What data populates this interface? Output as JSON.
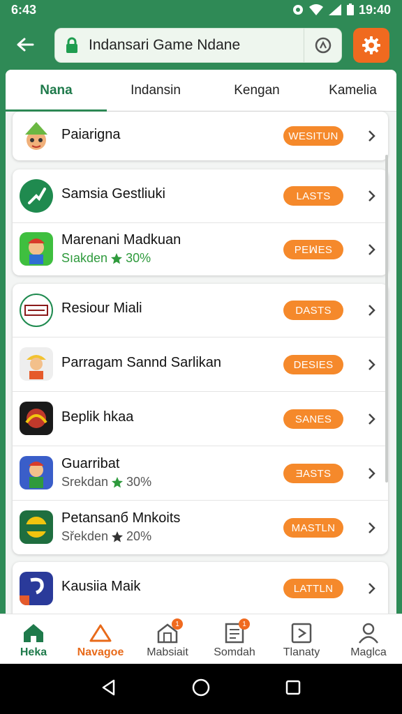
{
  "status": {
    "time": "6:43",
    "right_time": "19:40"
  },
  "topbar": {
    "url": "Indansari Game Ndane"
  },
  "tabs": [
    "Nana",
    "Indansin",
    "Kengan",
    "Kamelia"
  ],
  "list": [
    {
      "name": "Paiarigna",
      "sub": "",
      "sub_pct": "",
      "button": "WESITUN"
    },
    {
      "name": "Samsia Gestliuki",
      "sub": "",
      "sub_pct": "",
      "button": "LASTS"
    },
    {
      "name": "Marenani Madkuan",
      "sub": "Sıakden",
      "sub_pct": "30%",
      "button": "PEꟽES"
    },
    {
      "name": "Resiour Miali",
      "sub": "",
      "sub_pct": "",
      "button": "DASTS"
    },
    {
      "name": "Parragam Sannd Sarlikan",
      "sub": "",
      "sub_pct": "",
      "button": "DESIES"
    },
    {
      "name": "Beplik hkaa",
      "sub": "",
      "sub_pct": "",
      "button": "SANES"
    },
    {
      "name": "Guarribat",
      "sub": "Srekdan",
      "sub_pct": "30%",
      "button": "ƎASTS"
    },
    {
      "name": "Petansanб Mnkoits",
      "sub": "Sřekden",
      "sub_pct": "20%",
      "button": "MASTLN"
    },
    {
      "name": "Kausiia Maik",
      "sub": "",
      "sub_pct": "",
      "button": "LATTLN"
    }
  ],
  "bottom_nav": [
    {
      "label": "Heka",
      "icon": "home-icon",
      "badge": ""
    },
    {
      "label": "Navagoe",
      "icon": "navigate-icon",
      "badge": ""
    },
    {
      "label": "Mabsiait",
      "icon": "store-icon",
      "badge": "1"
    },
    {
      "label": "Somdah",
      "icon": "document-icon",
      "badge": "1"
    },
    {
      "label": "Tlanaty",
      "icon": "play-icon",
      "badge": ""
    },
    {
      "label": "Maglca",
      "icon": "profile-icon",
      "badge": ""
    }
  ],
  "colors": {
    "brand_green": "#2e8b57",
    "accent_orange": "#f5892b"
  }
}
